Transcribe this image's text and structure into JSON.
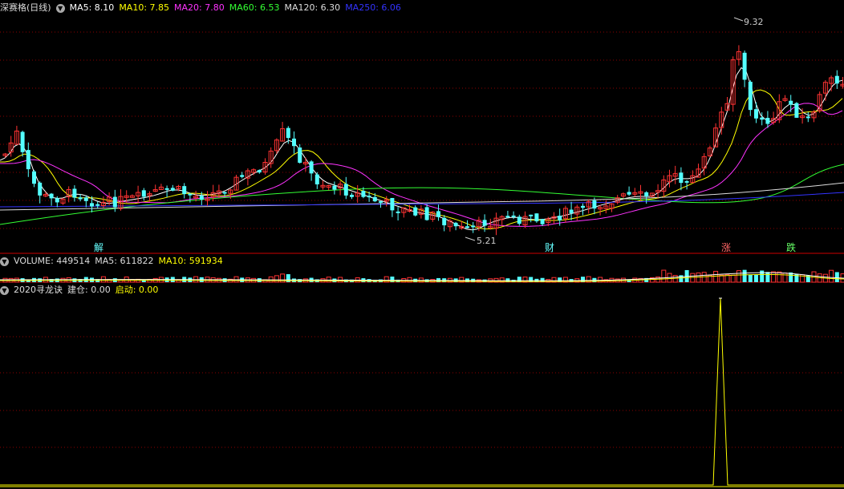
{
  "main_header": {
    "stock_title": "深赛格(日线)",
    "ma": [
      {
        "label": "MA5: 8.10",
        "color": "#ffffff"
      },
      {
        "label": "MA10: 7.85",
        "color": "#ffff00"
      },
      {
        "label": "MA20: 7.80",
        "color": "#ff33ff"
      },
      {
        "label": "MA60: 6.53",
        "color": "#33ff33"
      },
      {
        "label": "MA120: 6.30",
        "color": "#dddddd"
      },
      {
        "label": "MA250: 6.06",
        "color": "#3333ff"
      }
    ]
  },
  "annotations": {
    "high_label": "9.32",
    "low_label": "5.21"
  },
  "markers": [
    {
      "text": "解",
      "color": "#66ffff"
    },
    {
      "text": "财",
      "color": "#66ffff"
    },
    {
      "text": "涨",
      "color": "#ff6666"
    },
    {
      "text": "跌",
      "color": "#66ff66"
    }
  ],
  "volume_header": {
    "volume": "VOLUME: 449514",
    "ma5": "MA5: 611822",
    "ma10": "MA10: 591934"
  },
  "indicator_header": {
    "name": "2020寻龙诀",
    "jiancang": "建仓: 0.00",
    "qidong": "启动: 0.00"
  },
  "colors": {
    "up": "#ff3333",
    "down": "#54ffff",
    "grid": "#8b0000",
    "separator": "#cc0000"
  }
}
